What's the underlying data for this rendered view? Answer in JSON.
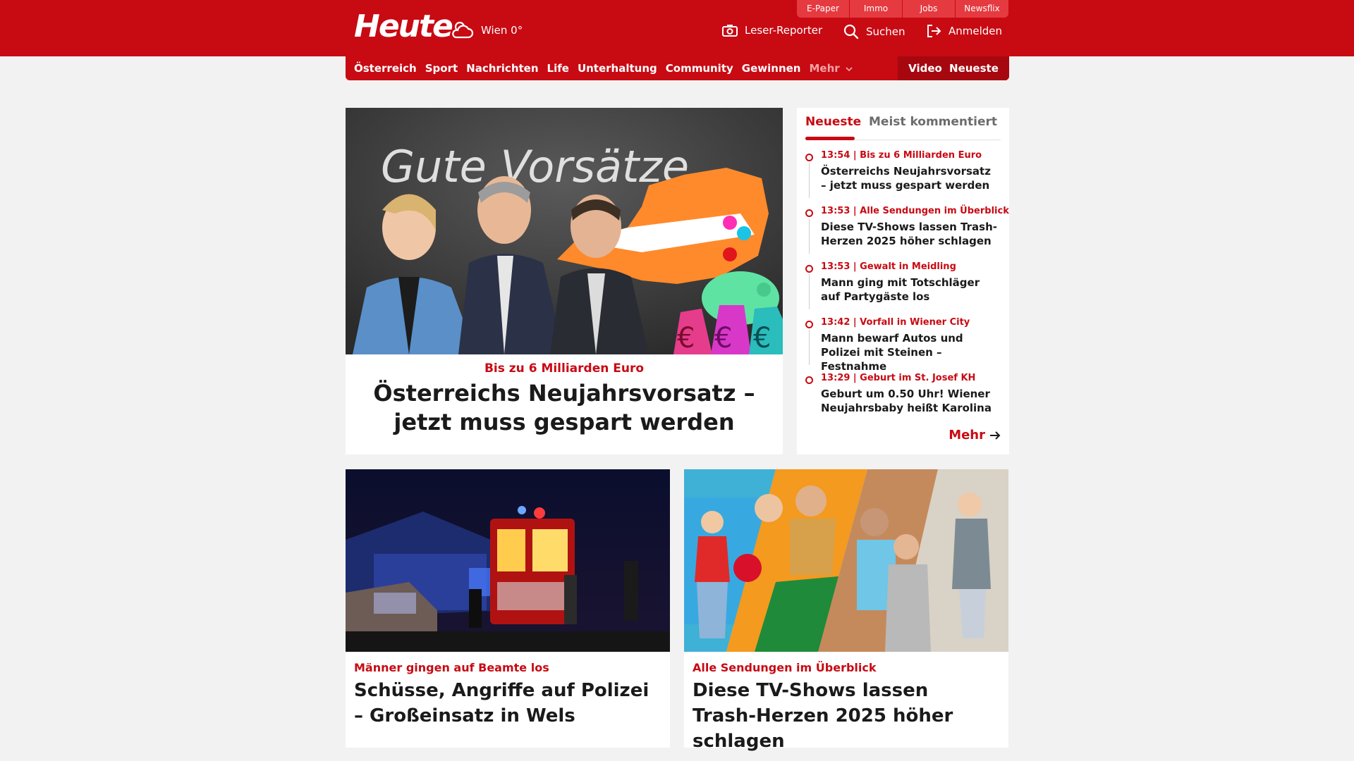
{
  "brand": {
    "logo": "Heute",
    "weather": "Wien 0°",
    "colors": {
      "primary": "#c80a13",
      "nav_dark": "#a70810",
      "top_link": "#e53a40"
    }
  },
  "top_links": [
    "E-Paper",
    "Immo",
    "Jobs",
    "Newsflix"
  ],
  "tools": {
    "reporter": {
      "label": "Leser-Reporter",
      "icon": "camera-icon"
    },
    "search": {
      "label": "Suchen",
      "icon": "search-icon"
    },
    "login": {
      "label": "Anmelden",
      "icon": "login-icon"
    }
  },
  "nav": {
    "items": [
      "Österreich",
      "Sport",
      "Nachrichten",
      "Life",
      "Unterhaltung",
      "Community",
      "Gewinnen"
    ],
    "more": "Mehr",
    "right": [
      "Video",
      "Neueste"
    ]
  },
  "hero": {
    "kicker": "Bis zu 6 Milliarden Euro",
    "title": "Österreichs Neujahrsvorsatz – jetzt muss gespart werden",
    "image_caption": "Gute Vorsätze"
  },
  "sidebar": {
    "tabs": [
      "Neueste",
      "Meist kommentiert"
    ],
    "items": [
      {
        "kicker": "13:54 | Bis zu 6 Milliarden Euro",
        "title": "Österreichs Neujahrsvorsatz – jetzt muss gespart werden"
      },
      {
        "kicker": "13:53 | Alle Sendungen im Überblick",
        "title": "Diese TV-Shows lassen Trash-Herzen 2025 höher schlagen"
      },
      {
        "kicker": "13:53 | Gewalt in Meidling",
        "title": "Mann ging mit Totschläger auf Partygäste los"
      },
      {
        "kicker": "13:42 | Vorfall in Wiener City",
        "title": "Mann bewarf Autos und Polizei mit Steinen – Festnahme"
      },
      {
        "kicker": "13:29 | Geburt im St. Josef KH",
        "title": "Geburt um 0.50 Uhr! Wiener Neujahrsbaby heißt Karolina"
      }
    ],
    "more": "Mehr"
  },
  "teasers": [
    {
      "kicker": "Männer gingen auf Beamte los",
      "title": "Schüsse, Angriffe auf Polizei – Großeinsatz in Wels"
    },
    {
      "kicker": "Alle Sendungen im Überblick",
      "title": "Diese TV-Shows lassen Trash-Herzen 2025 höher schlagen"
    }
  ]
}
